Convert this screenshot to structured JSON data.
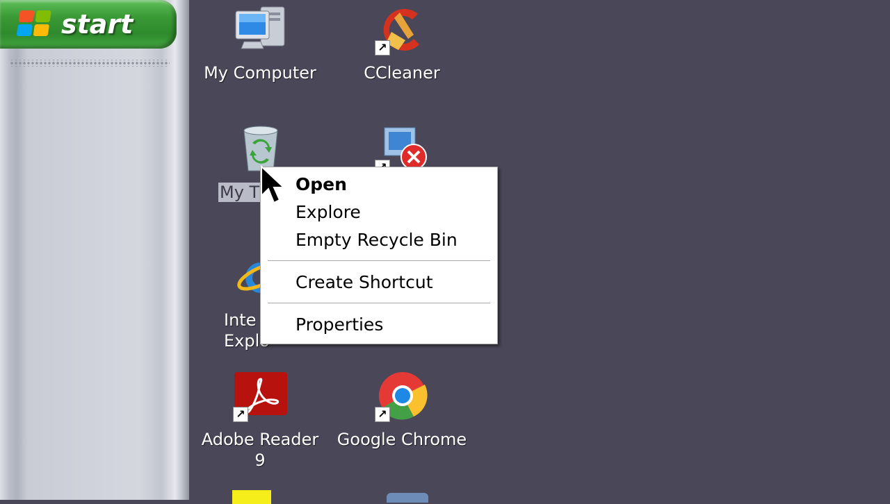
{
  "taskbar": {
    "start_label": "start"
  },
  "desktop": {
    "icons": [
      {
        "label": "My Computer",
        "icon": "my-computer-icon"
      },
      {
        "label": "CCleaner",
        "icon": "ccleaner-icon"
      },
      {
        "label": "My T",
        "icon": "recycle-bin-icon"
      },
      {
        "label": "",
        "icon": "network-error-icon"
      },
      {
        "label": "Inte\nExplo",
        "icon": "internet-explorer-icon"
      },
      {
        "label": "Adobe Reader\n9",
        "icon": "adobe-reader-icon"
      },
      {
        "label": "Google Chrome",
        "icon": "google-chrome-icon"
      }
    ]
  },
  "context_menu": {
    "open": "Open",
    "explore": "Explore",
    "empty_recycle_bin": "Empty Recycle Bin",
    "create_shortcut": "Create Shortcut",
    "properties": "Properties"
  },
  "colors": {
    "desktop_bg": "#4a4858",
    "start_green": "#3a9a35"
  }
}
